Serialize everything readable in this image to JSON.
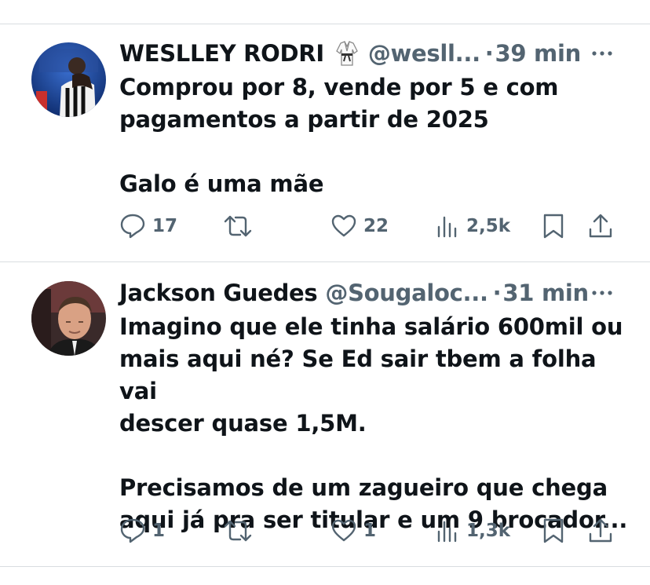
{
  "tweets": [
    {
      "name": "WESLLEY RODRI",
      "handle": "@wesll...",
      "separator": "·",
      "time": "39 min",
      "text": [
        "Comprou por 8, vende por 5 e com",
        "pagamentos a partir de 2025",
        "Galo é uma mãe"
      ],
      "replies": "17",
      "retweets": "",
      "likes": "22",
      "views": "2,5k"
    },
    {
      "name": "Jackson Guedes",
      "handle": "@Sougaloc...",
      "separator": "·",
      "time": "31 min",
      "text": [
        "Imagino que ele tinha salário 600mil ou",
        "mais aqui né? Se Ed sair tbem a folha vai",
        "descer quase 1,5M.",
        "Precisamos de um zagueiro que chega",
        "aqui já pra ser titular e um 9 brocador..."
      ],
      "replies": "1",
      "retweets": "",
      "likes": "1",
      "views": "1,3k"
    }
  ],
  "icons": {
    "reply": "reply-icon",
    "retweet": "retweet-icon",
    "like": "heart-icon",
    "views": "views-icon",
    "bookmark": "bookmark-icon",
    "share": "share-icon",
    "more": "more-icon",
    "badge": "karate-gi-icon"
  },
  "colors": {
    "text": "#0f1419",
    "muted": "#536471",
    "divider": "#d9dde0"
  }
}
